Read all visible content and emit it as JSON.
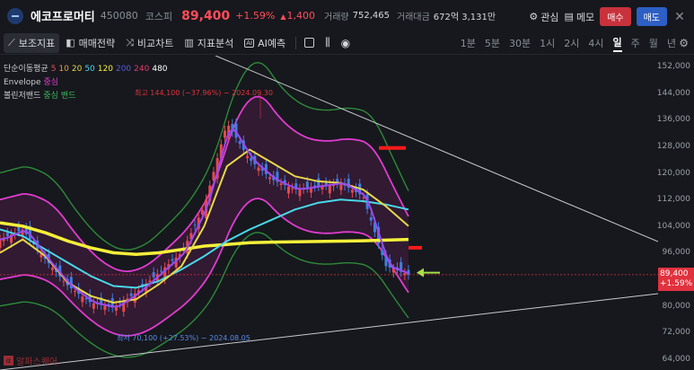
{
  "header": {
    "stock_name": "에코프로머티",
    "stock_code": "450080",
    "market": "코스피",
    "price": "89,400",
    "change_pct": "+1.59%",
    "change_abs": "1,400",
    "volume_label": "거래량",
    "volume": "752,465",
    "amount_label": "거래대금",
    "amount": "672억 3,131만",
    "favorite_label": "관심",
    "memo_label": "메모",
    "buy_label": "매수",
    "sell_label": "매도",
    "close_icon": "close-icon"
  },
  "toolbar": {
    "tools": [
      "보조지표",
      "매매전략",
      "비교차트",
      "지표분석",
      "AI예측"
    ],
    "periods": [
      "1분",
      "5분",
      "30분",
      "1시",
      "2시",
      "4시",
      "일",
      "주",
      "월",
      "년"
    ],
    "active_period": "일"
  },
  "legend": {
    "ma_label": "단순이동평균",
    "ma_values": [
      {
        "text": "5",
        "color": "#e0505a"
      },
      {
        "text": "10",
        "color": "#e8a03c"
      },
      {
        "text": "20",
        "color": "#e6d84a"
      },
      {
        "text": "50",
        "color": "#4ad8e8"
      },
      {
        "text": "120",
        "color": "#f5f03a"
      },
      {
        "text": "200",
        "color": "#5a5ae0"
      },
      {
        "text": "240",
        "color": "#e03c6e"
      },
      {
        "text": "480",
        "color": "#ffffff"
      }
    ],
    "envelope_label": "Envelope",
    "envelope_sub": "중심",
    "bollinger_label": "볼린저밴드",
    "bollinger_sub": "중심 밴드"
  },
  "annotations": {
    "high": "최고 144,100 (−37.96%) − 2024.09.30",
    "low": "최저 70,100 (+27.53%) − 2024.08.05"
  },
  "axis": {
    "ticks": [
      "152,000",
      "144,000",
      "136,000",
      "128,000",
      "120,000",
      "112,000",
      "104,000",
      "96,000",
      "88,000",
      "80,000",
      "72,000",
      "64,000"
    ],
    "current_price": "89,400",
    "current_change": "+1.59%"
  },
  "watermark": "알파스퀘어",
  "chart_data": {
    "type": "line",
    "ylim": [
      64000,
      152000
    ],
    "series": [
      {
        "name": "120",
        "color": "#f5f03a",
        "values": [
          105000,
          104000,
          102000,
          99500,
          97500,
          96000,
          95500,
          96000,
          97000,
          98000,
          98500,
          99000,
          99200,
          99300,
          99400,
          99500,
          99600,
          99800,
          100000
        ]
      },
      {
        "name": "50",
        "color": "#4ad8e8",
        "values": [
          103000,
          101000,
          97000,
          93000,
          89000,
          86000,
          85500,
          87500,
          91000,
          95000,
          99500,
          103000,
          106000,
          109000,
          111000,
          112000,
          111500,
          110500,
          109000
        ]
      },
      {
        "name": "20",
        "color": "#e6d84a",
        "values": [
          96000,
          100000,
          95000,
          87000,
          83000,
          81000,
          82000,
          86500,
          92000,
          104000,
          122000,
          127000,
          123000,
          119000,
          117500,
          117000,
          115000,
          110000,
          104000
        ]
      }
    ],
    "price_close": [
      100000,
      103000,
      94000,
      86000,
      81000,
      79500,
      84000,
      90000,
      96000,
      110000,
      135000,
      124000,
      118000,
      115000,
      116000,
      117000,
      113000,
      92000,
      89400
    ]
  }
}
